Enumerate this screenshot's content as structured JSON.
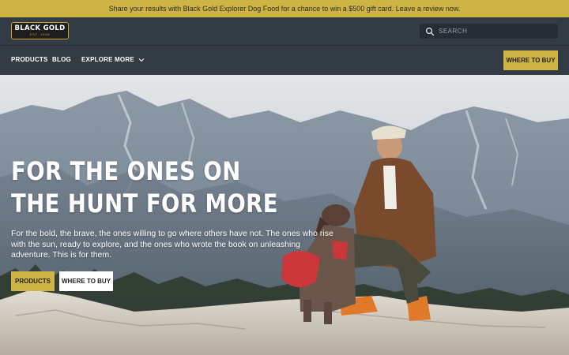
{
  "announcement": {
    "text": "Share your results with Black Gold Explorer Dog Food for a chance to win a $500 gift card. Leave a review now."
  },
  "header": {
    "logo_text": "BLACK GOLD",
    "logo_sub": "EST. 1955",
    "search_placeholder": "SEARCH",
    "search_icon": "search-icon"
  },
  "nav": {
    "items": [
      {
        "label": "PRODUCTS"
      },
      {
        "label": "BLOG"
      },
      {
        "label": "EXPLORE MORE"
      }
    ],
    "cta_label": "WHERE TO BUY"
  },
  "hero": {
    "title": "FOR THE ONES ON THE HUNT FOR MORE",
    "text": "For the bold, the brave, the ones willing to go where others have not. The ones who rise with the sun, ready to explore, and the ones who wrote the book on unleashing adventure. This is for them.",
    "primary_button": "PRODUCTS",
    "secondary_button": "WHERE TO BUY"
  },
  "colors": {
    "brand_gold": "#cdb445",
    "header_bg": "#333c45"
  }
}
